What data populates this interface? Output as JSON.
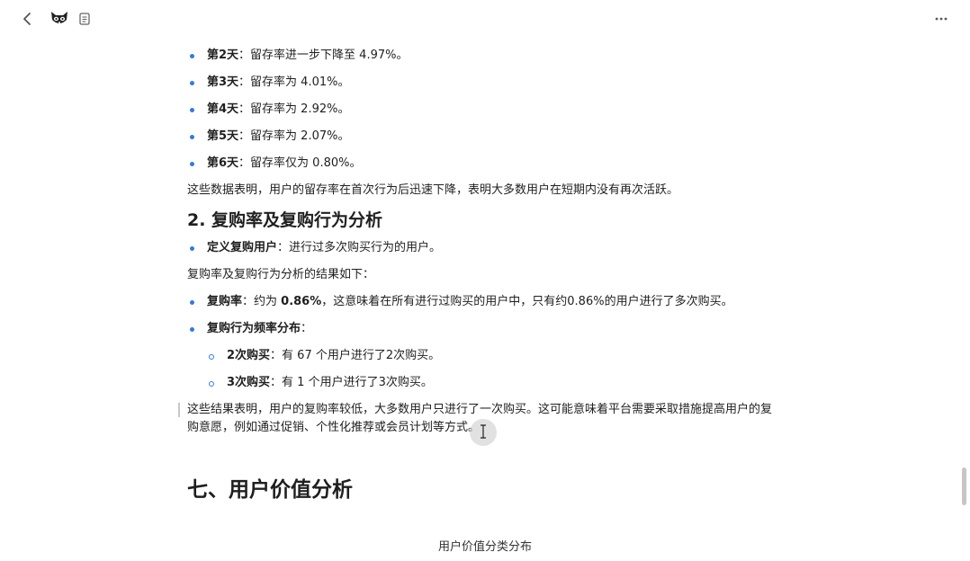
{
  "toolbar": {
    "back_icon": "chevron-left-icon",
    "logo_icon": "raccoon-logo-icon",
    "doc_icon": "document-icon",
    "more_icon": "more-horizontal-icon"
  },
  "retention": [
    {
      "day": "第2天",
      "text": "：留存率进一步下降至 4.97%。"
    },
    {
      "day": "第3天",
      "text": "：留存率为 4.01%。"
    },
    {
      "day": "第4天",
      "text": "：留存率为 2.92%。"
    },
    {
      "day": "第5天",
      "text": "：留存率为 2.07%。"
    },
    {
      "day": "第6天",
      "text": "：留存率仅为 0.80%。"
    }
  ],
  "retention_summary": "这些数据表明，用户的留存率在首次行为后迅速下降，表明大多数用户在短期内没有再次活跃。",
  "section2": {
    "heading": "2. 复购率及复购行为分析",
    "definition_label": "定义复购用户",
    "definition_text": "：进行过多次购买行为的用户。",
    "intro": "复购率及复购行为分析的结果如下：",
    "rate_label": "复购率",
    "rate_prefix": "：约为 ",
    "rate_value": "0.86%",
    "rate_text": "，这意味着在所有进行过购买的用户中，只有约0.86%的用户进行了多次购买。",
    "freq_label": "复购行为频率分布",
    "freq_colon": "：",
    "freq_items": [
      {
        "label": "2次购买",
        "text": "：有 67 个用户进行了2次购买。"
      },
      {
        "label": "3次购买",
        "text": "：有 1 个用户进行了3次购买。"
      }
    ],
    "conclusion_line1": "这些结果表明，用户的复购率较低，大多数用户只进行了一次购买。这可能意味着平台需要采取措施提高用户的复",
    "conclusion_line2": "购意愿，例如通过促销、个性化推荐或会员计划等方式。"
  },
  "section7": {
    "heading": "七、用户价值分析",
    "chart_title": "用户价值分类分布"
  },
  "colors": {
    "bullet": "#2f7ae5",
    "text": "#1f1f1f"
  }
}
